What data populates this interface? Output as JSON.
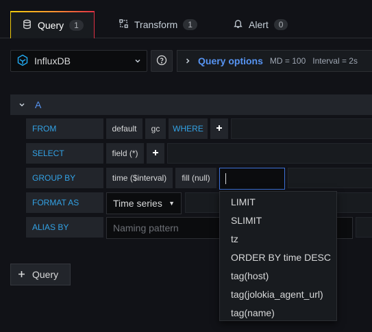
{
  "tabs": [
    {
      "label": "Query",
      "count": "1",
      "icon": "database-icon"
    },
    {
      "label": "Transform",
      "count": "1",
      "icon": "transform-icon"
    },
    {
      "label": "Alert",
      "count": "0",
      "icon": "bell-icon"
    }
  ],
  "datasource": {
    "name": "InfluxDB",
    "icon": "influxdb-icon"
  },
  "query_options": {
    "title": "Query options",
    "md": "MD = 100",
    "interval": "Interval = 2s"
  },
  "query": {
    "letter": "A",
    "from": {
      "label": "FROM",
      "policy": "default",
      "measurement": "gc",
      "where": "WHERE"
    },
    "select": {
      "label": "SELECT",
      "field": "field (*)"
    },
    "group_by": {
      "label": "GROUP BY",
      "time": "time ($interval)",
      "fill": "fill (null)",
      "input_value": ""
    },
    "format_as": {
      "label": "FORMAT AS",
      "value": "Time series"
    },
    "alias_by": {
      "label": "ALIAS BY",
      "placeholder": "Naming pattern"
    }
  },
  "add_query_label": "Query",
  "dropdown_options": [
    "LIMIT",
    "SLIMIT",
    "tz",
    "ORDER BY time DESC",
    "tag(host)",
    "tag(jolokia_agent_url)",
    "tag(name)"
  ],
  "colors": {
    "accent": "#33a2e5",
    "link": "#5794f2",
    "background": "#111217"
  }
}
